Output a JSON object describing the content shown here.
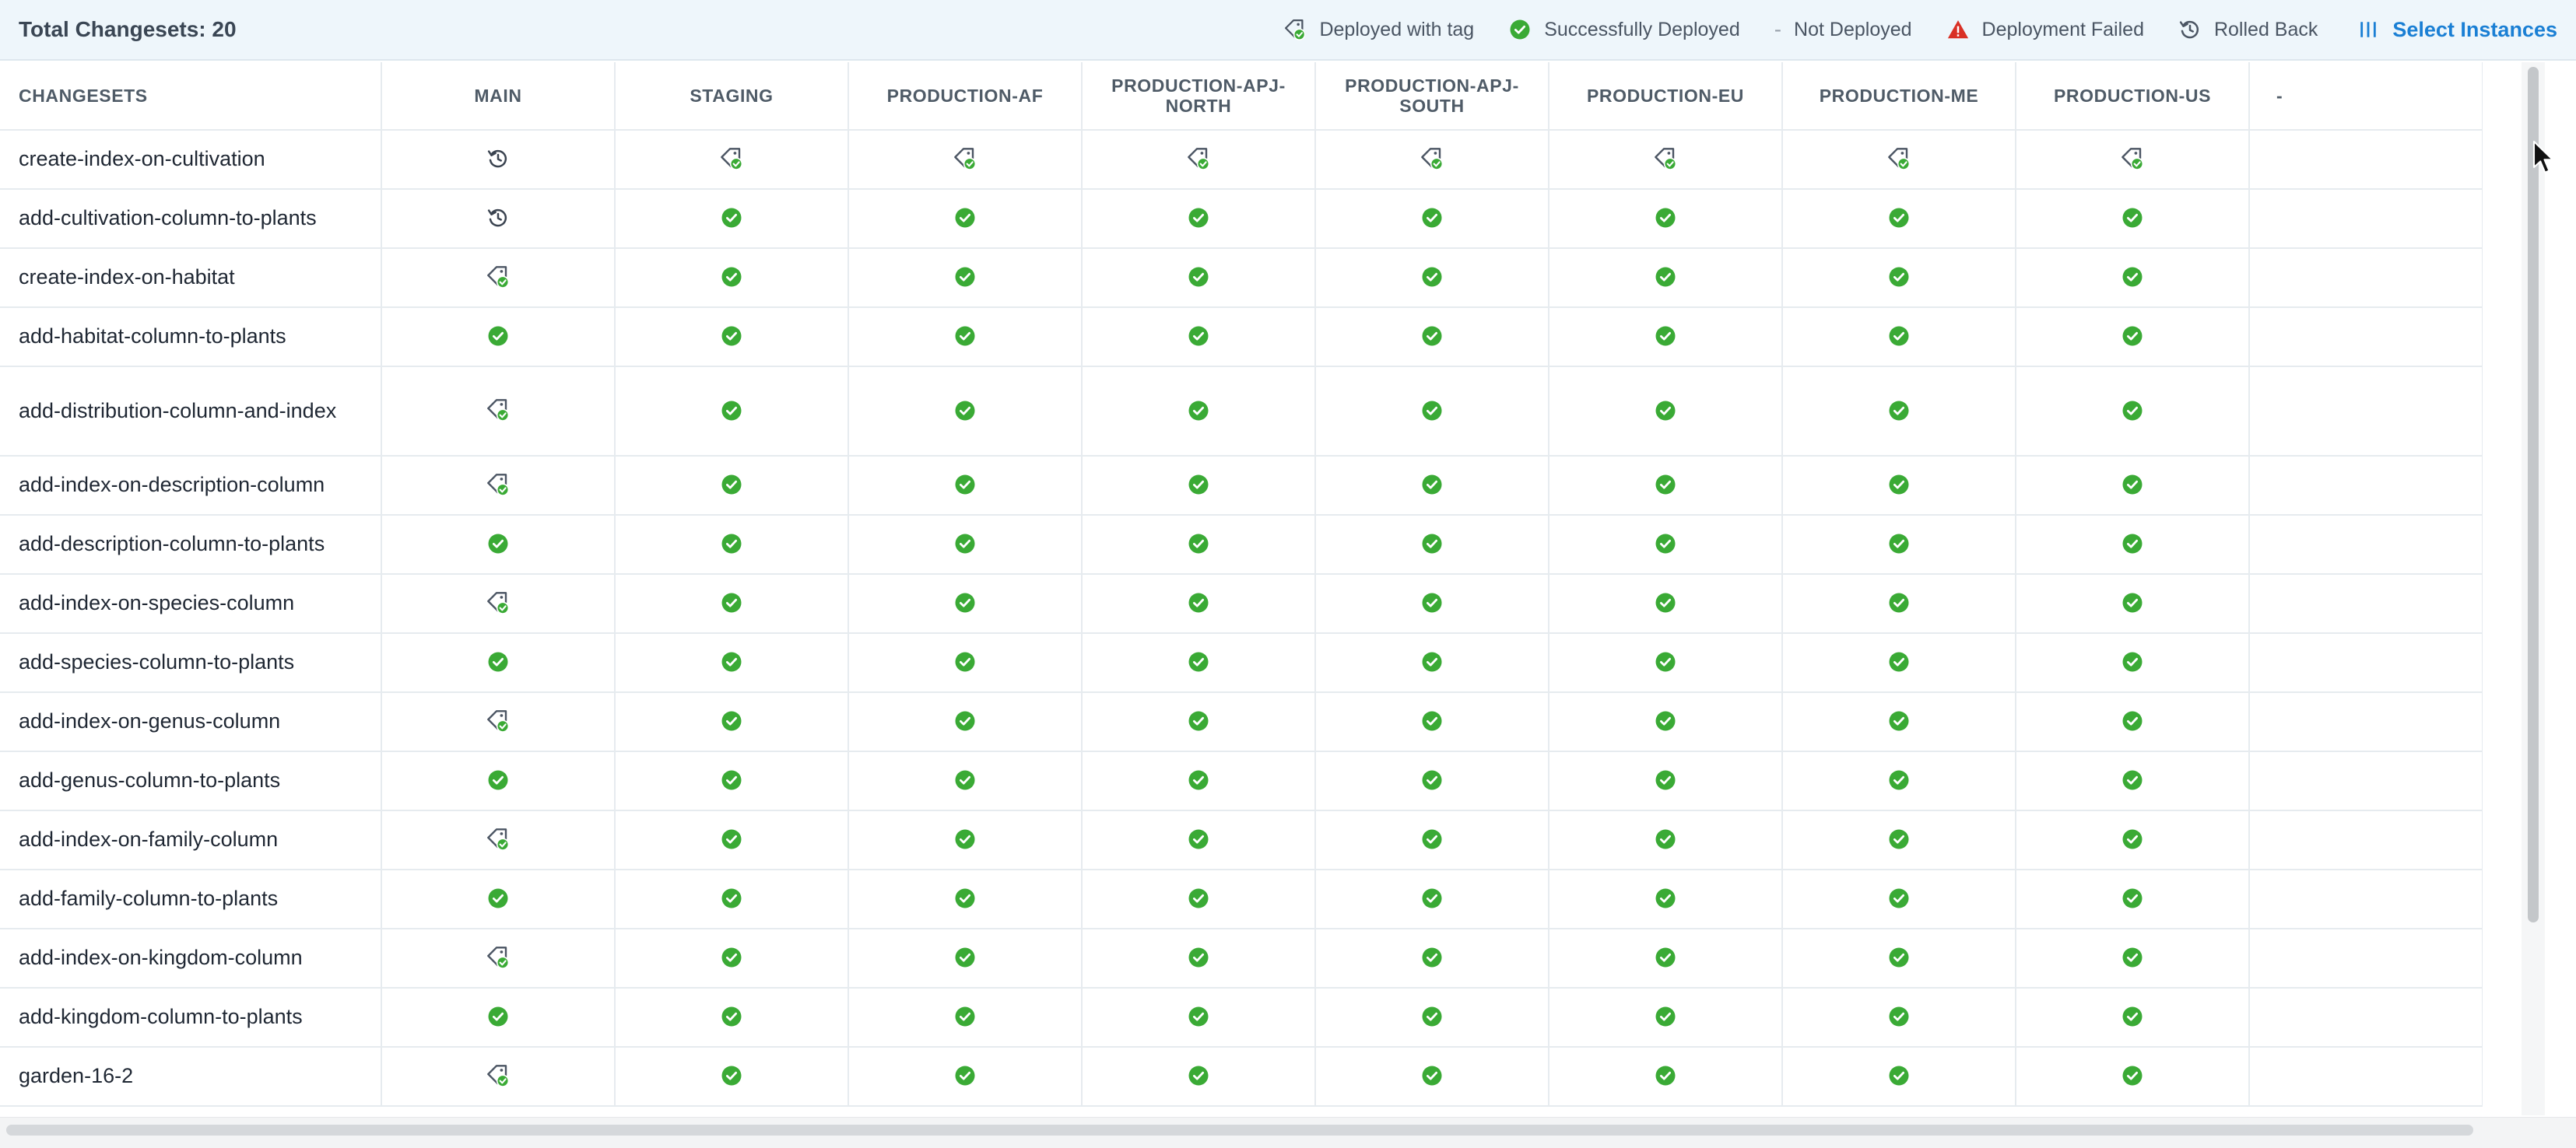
{
  "summary": {
    "total_label": "Total Changesets: 20"
  },
  "legend": [
    {
      "label": "Deployed with tag",
      "icon": "tag-check-icon"
    },
    {
      "label": "Successfully Deployed",
      "icon": "check-circle-icon"
    },
    {
      "label": "Not Deployed",
      "icon": "dash-icon",
      "glyph": "-"
    },
    {
      "label": "Deployment Failed",
      "icon": "warning-triangle-icon"
    },
    {
      "label": "Rolled Back",
      "icon": "rollback-icon"
    }
  ],
  "select_instances": {
    "label": "Select Instances",
    "icon": "columns-icon"
  },
  "colors": {
    "success": "#3aaa35",
    "failed": "#d93025",
    "accent": "#1a7fd4",
    "header_bg": "#eef6fb"
  },
  "table": {
    "headers": [
      "CHANGESETS",
      "MAIN",
      "STAGING",
      "PRODUCTION-AF",
      "PRODUCTION-APJ-NORTH",
      "PRODUCTION-APJ-SOUTH",
      "PRODUCTION-EU",
      "PRODUCTION-ME",
      "PRODUCTION-US",
      "-"
    ],
    "rows": [
      {
        "name": "create-index-on-cultivation",
        "statuses": [
          "rolled_back",
          "tag",
          "tag",
          "tag",
          "tag",
          "tag",
          "tag",
          "tag"
        ]
      },
      {
        "name": "add-cultivation-column-to-plants",
        "statuses": [
          "rolled_back",
          "success",
          "success",
          "success",
          "success",
          "success",
          "success",
          "success"
        ]
      },
      {
        "name": "create-index-on-habitat",
        "statuses": [
          "tag",
          "success",
          "success",
          "success",
          "success",
          "success",
          "success",
          "success"
        ]
      },
      {
        "name": "add-habitat-column-to-plants",
        "statuses": [
          "success",
          "success",
          "success",
          "success",
          "success",
          "success",
          "success",
          "success"
        ]
      },
      {
        "name": "add-distribution-column-and-index",
        "statuses": [
          "tag",
          "success",
          "success",
          "success",
          "success",
          "success",
          "success",
          "success"
        ],
        "tall": true
      },
      {
        "name": "add-index-on-description-column",
        "statuses": [
          "tag",
          "success",
          "success",
          "success",
          "success",
          "success",
          "success",
          "success"
        ]
      },
      {
        "name": "add-description-column-to-plants",
        "statuses": [
          "success",
          "success",
          "success",
          "success",
          "success",
          "success",
          "success",
          "success"
        ]
      },
      {
        "name": "add-index-on-species-column",
        "statuses": [
          "tag",
          "success",
          "success",
          "success",
          "success",
          "success",
          "success",
          "success"
        ]
      },
      {
        "name": "add-species-column-to-plants",
        "statuses": [
          "success",
          "success",
          "success",
          "success",
          "success",
          "success",
          "success",
          "success"
        ]
      },
      {
        "name": "add-index-on-genus-column",
        "statuses": [
          "tag",
          "success",
          "success",
          "success",
          "success",
          "success",
          "success",
          "success"
        ]
      },
      {
        "name": "add-genus-column-to-plants",
        "statuses": [
          "success",
          "success",
          "success",
          "success",
          "success",
          "success",
          "success",
          "success"
        ]
      },
      {
        "name": "add-index-on-family-column",
        "statuses": [
          "tag",
          "success",
          "success",
          "success",
          "success",
          "success",
          "success",
          "success"
        ]
      },
      {
        "name": "add-family-column-to-plants",
        "statuses": [
          "success",
          "success",
          "success",
          "success",
          "success",
          "success",
          "success",
          "success"
        ]
      },
      {
        "name": "add-index-on-kingdom-column",
        "statuses": [
          "tag",
          "success",
          "success",
          "success",
          "success",
          "success",
          "success",
          "success"
        ]
      },
      {
        "name": "add-kingdom-column-to-plants",
        "statuses": [
          "success",
          "success",
          "success",
          "success",
          "success",
          "success",
          "success",
          "success"
        ]
      },
      {
        "name": "garden-16-2",
        "statuses": [
          "tag",
          "success",
          "success",
          "success",
          "success",
          "success",
          "success",
          "success"
        ]
      }
    ]
  }
}
